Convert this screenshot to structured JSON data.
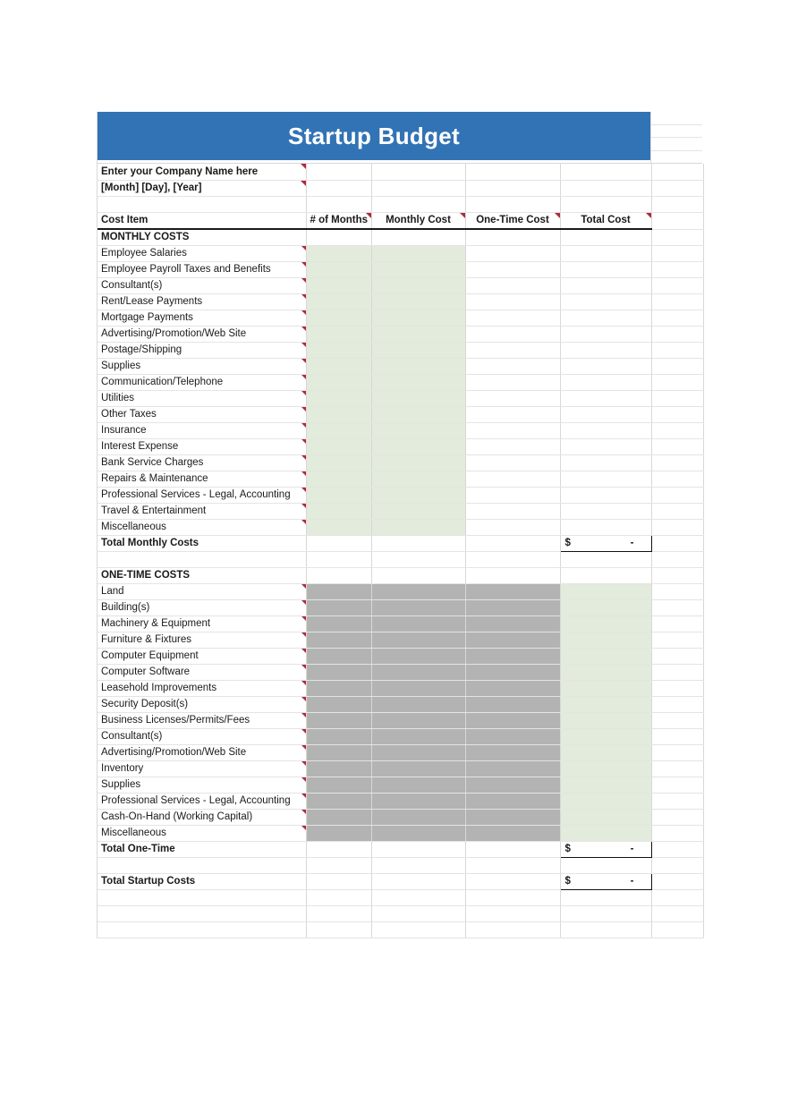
{
  "banner": {
    "title": "Startup Budget",
    "bg": "#3273B5",
    "text_color": "#FFFFFF"
  },
  "company": {
    "name_placeholder": "Enter your Company Name here",
    "date_placeholder": "[Month] [Day], [Year]"
  },
  "colors": {
    "input_fill": "#E3EBDC",
    "blocked_fill_pattern": "crosshatch",
    "comment_marker": "#B02A3A"
  },
  "columns": [
    {
      "key": "cost_item",
      "label": "Cost Item",
      "align": "left"
    },
    {
      "key": "num_months",
      "label": "# of Months",
      "align": "center"
    },
    {
      "key": "monthly_cost",
      "label": "Monthly Cost",
      "align": "center"
    },
    {
      "key": "one_time_cost",
      "label": "One-Time Cost",
      "align": "center"
    },
    {
      "key": "total_cost",
      "label": "Total Cost",
      "align": "center"
    }
  ],
  "sections": [
    {
      "title": "MONTHLY COSTS",
      "rows": [
        "Employee Salaries",
        "Employee Payroll Taxes and Benefits",
        "Consultant(s)",
        "Rent/Lease Payments",
        "Mortgage Payments",
        "Advertising/Promotion/Web Site",
        "Postage/Shipping",
        "Supplies",
        "Communication/Telephone",
        "Utilities",
        "Other Taxes",
        "Insurance",
        "Interest Expense",
        "Bank Service Charges",
        "Repairs & Maintenance",
        "Professional Services - Legal, Accounting",
        "Travel & Entertainment",
        "Miscellaneous"
      ],
      "total": {
        "label": "Total Monthly Costs",
        "currency": "$",
        "value": "-"
      }
    },
    {
      "title": "ONE-TIME COSTS",
      "rows": [
        "Land",
        "Building(s)",
        "Machinery & Equipment",
        "Furniture & Fixtures",
        "Computer Equipment",
        "Computer Software",
        "Leasehold Improvements",
        "Security Deposit(s)",
        "Business Licenses/Permits/Fees",
        "Consultant(s)",
        "Advertising/Promotion/Web Site",
        "Inventory",
        "Supplies",
        "Professional Services - Legal, Accounting",
        "Cash-On-Hand (Working Capital)",
        "Miscellaneous"
      ],
      "total": {
        "label": "Total One-Time",
        "currency": "$",
        "value": "-"
      }
    }
  ],
  "grand_total": {
    "label": "Total Startup Costs",
    "currency": "$",
    "value": "-"
  }
}
